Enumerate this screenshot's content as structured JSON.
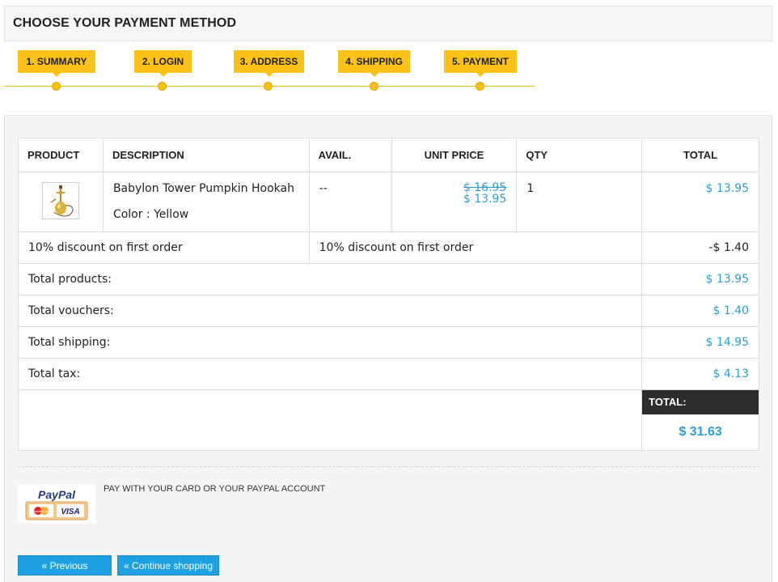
{
  "header": {
    "title": "CHOOSE YOUR PAYMENT METHOD"
  },
  "steps": [
    {
      "label": "1. SUMMARY"
    },
    {
      "label": "2. LOGIN"
    },
    {
      "label": "3. ADDRESS"
    },
    {
      "label": "4. SHIPPING"
    },
    {
      "label": "5. PAYMENT"
    }
  ],
  "cart": {
    "columns": [
      "PRODUCT",
      "DESCRIPTION",
      "AVAIL.",
      "UNIT PRICE",
      "QTY",
      "TOTAL"
    ],
    "product": {
      "name": "Babylon Tower Pumpkin Hookah",
      "attributes": "Color : Yellow",
      "availability": "--",
      "old_price": "$ 16.95",
      "unit_price": "$ 13.95",
      "qty": "1",
      "total": "$ 13.95"
    },
    "discount": {
      "name": "10% discount on first order",
      "description": "10% discount on first order",
      "amount": "-$ 1.40"
    },
    "summary": [
      {
        "label": "Total products:",
        "value": "$ 13.95"
      },
      {
        "label": "Total vouchers:",
        "value": "$ 1.40"
      },
      {
        "label": "Total shipping:",
        "value": "$ 14.95"
      },
      {
        "label": "Total tax:",
        "value": "$ 4.13"
      }
    ],
    "total_label": "TOTAL:",
    "total_value": "$ 31.63"
  },
  "payment": {
    "logo_text": "PayPal",
    "card1": "MasterCard",
    "card2": "VISA",
    "paypal_label": "PAY WITH YOUR CARD OR YOUR PAYPAL ACCOUNT"
  },
  "buttons": {
    "previous": "« Previous",
    "continue": "« Continue shopping"
  },
  "colors": {
    "accent": "#fbc21a",
    "price": "#2a9fd6",
    "button": "#1da1e2"
  }
}
